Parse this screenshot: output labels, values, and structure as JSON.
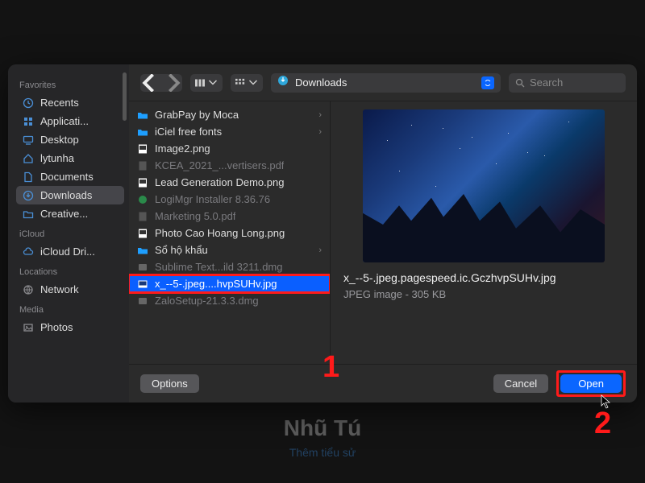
{
  "background": {
    "title": "Nhũ Tú",
    "subtitle": "Thêm tiểu sử"
  },
  "sidebar": {
    "sections": [
      {
        "title": "Favorites",
        "items": [
          {
            "label": "Recents",
            "icon": "clock"
          },
          {
            "label": "Applicati...",
            "icon": "apps"
          },
          {
            "label": "Desktop",
            "icon": "desktop"
          },
          {
            "label": "lytunha",
            "icon": "home"
          },
          {
            "label": "Documents",
            "icon": "doc"
          },
          {
            "label": "Downloads",
            "icon": "down",
            "active": true
          },
          {
            "label": "Creative...",
            "icon": "folder"
          }
        ]
      },
      {
        "title": "iCloud",
        "items": [
          {
            "label": "iCloud Dri...",
            "icon": "cloud"
          }
        ]
      },
      {
        "title": "Locations",
        "items": [
          {
            "label": "Network",
            "icon": "globe"
          }
        ]
      },
      {
        "title": "Media",
        "items": [
          {
            "label": "Photos",
            "icon": "photo"
          }
        ]
      }
    ]
  },
  "toolbar": {
    "location": "Downloads",
    "search_placeholder": "Search"
  },
  "files": [
    {
      "label": "GrabPay by Moca",
      "icon": "folder-blue",
      "chev": true
    },
    {
      "label": "iCiel free fonts",
      "icon": "folder-blue",
      "chev": true
    },
    {
      "label": "Image2.png",
      "icon": "png"
    },
    {
      "label": "KCEA_2021_...vertisers.pdf",
      "icon": "pdf",
      "dim": true
    },
    {
      "label": "Lead Generation Demo.png",
      "icon": "png"
    },
    {
      "label": "LogiMgr Installer 8.36.76",
      "icon": "pkg",
      "dim": true
    },
    {
      "label": "Marketing 5.0.pdf",
      "icon": "pdf",
      "dim": true
    },
    {
      "label": "Photo Cao Hoang Long.png",
      "icon": "png"
    },
    {
      "label": "Sổ hộ khẩu",
      "icon": "folder-blue",
      "chev": true
    },
    {
      "label": "Sublime Text...ild 3211.dmg",
      "icon": "dmg",
      "dim": true
    },
    {
      "label": "x_--5-.jpeg....hvpSUHv.jpg",
      "icon": "img",
      "selected": true,
      "highlight": true
    },
    {
      "label": "ZaloSetup-21.3.3.dmg",
      "icon": "dmg",
      "dim": true
    }
  ],
  "preview": {
    "filename": "x_--5-.jpeg.pagespeed.ic.GczhvpSUHv.jpg",
    "meta": "JPEG image - 305 KB"
  },
  "footer": {
    "options": "Options",
    "cancel": "Cancel",
    "open": "Open"
  },
  "annotations": {
    "one": "1",
    "two": "2"
  }
}
